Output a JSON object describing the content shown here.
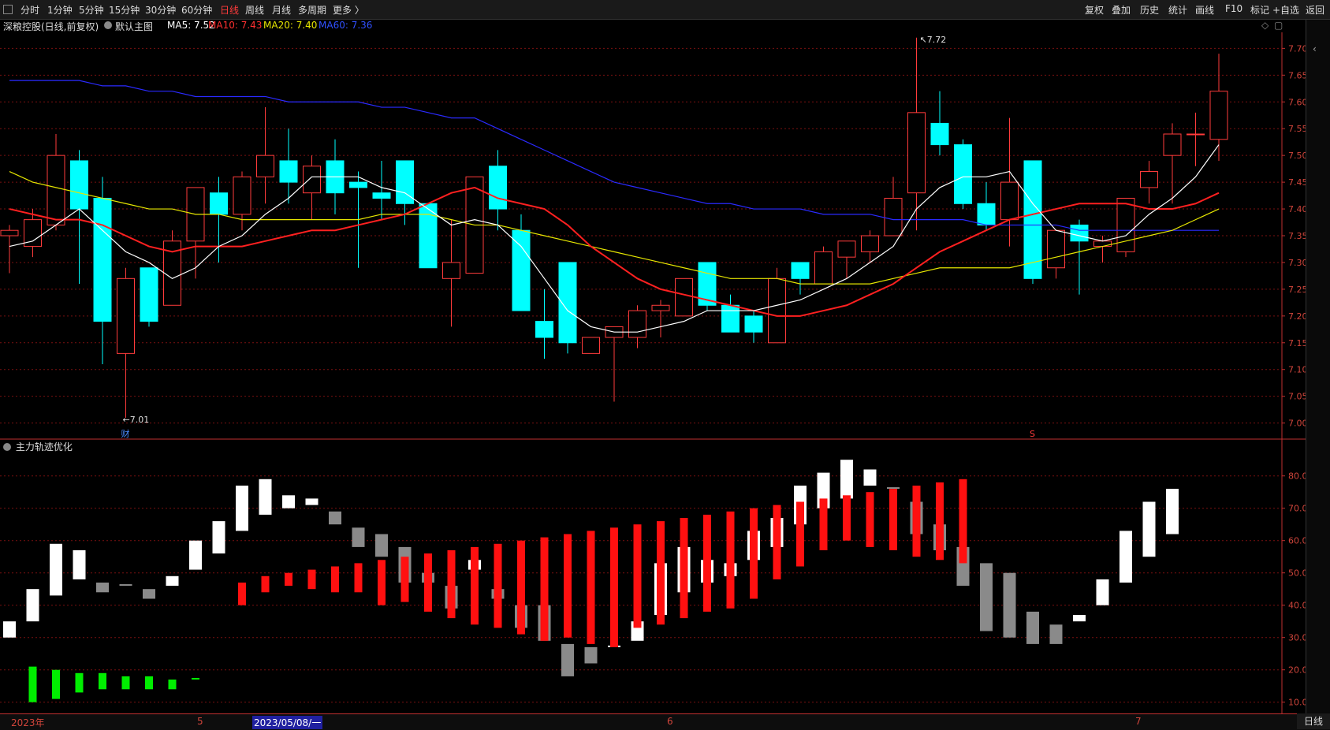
{
  "toolbar": {
    "periods": [
      "分时",
      "1分钟",
      "5分钟",
      "15分钟",
      "30分钟",
      "60分钟",
      "日线",
      "周线",
      "月线",
      "多周期",
      "更多 〉"
    ],
    "active_period": "日线",
    "right": [
      "复权",
      "叠加",
      "历史",
      "统计",
      "画线",
      "F10",
      "标记",
      "+自选",
      "返回"
    ]
  },
  "info": {
    "stock": "深粮控股(日线,前复权)",
    "template": "默认主图",
    "ma5": "MA5: 7.52",
    "ma10": "MA10: 7.43",
    "ma20": "MA20: 7.40",
    "ma60": "MA60: 7.36"
  },
  "indicator": {
    "name": "主力轨迹优化"
  },
  "annotations": {
    "high": "7.72",
    "low": "←7.01",
    "fin_marker": "财",
    "s_marker": "S"
  },
  "bottom": {
    "labels": [
      "2023年",
      "5",
      "2023/05/08/一",
      "6",
      "7"
    ],
    "period_button": "日线"
  },
  "colors": {
    "up": "#ff3b3b",
    "down": "#00ffff",
    "ma5": "#ffffff",
    "ma10": "#ff2020",
    "ma20": "#e6e600",
    "ma60": "#2a2aff",
    "grid": "#7a1010",
    "axis": "#c03030"
  },
  "chart_data": {
    "type": "candlestick",
    "y_range": [
      6.97,
      7.73
    ],
    "y_ticks": [
      "7.70",
      "7.65",
      "7.60",
      "7.55",
      "7.50",
      "7.45",
      "7.40",
      "7.35",
      "7.30",
      "7.25",
      "7.20",
      "7.15",
      "7.10",
      "7.05",
      "7.00"
    ],
    "ohlc": [
      [
        7.35,
        7.36,
        7.28,
        7.37
      ],
      [
        7.33,
        7.38,
        7.31,
        7.4
      ],
      [
        7.37,
        7.5,
        7.36,
        7.54
      ],
      [
        7.49,
        7.4,
        7.26,
        7.51
      ],
      [
        7.42,
        7.19,
        7.11,
        7.46
      ],
      [
        7.13,
        7.27,
        7.01,
        7.29
      ],
      [
        7.29,
        7.19,
        7.18,
        7.29
      ],
      [
        7.22,
        7.34,
        7.22,
        7.36
      ],
      [
        7.34,
        7.44,
        7.27,
        7.44
      ],
      [
        7.43,
        7.39,
        7.3,
        7.46
      ],
      [
        7.39,
        7.46,
        7.36,
        7.47
      ],
      [
        7.46,
        7.5,
        7.41,
        7.59
      ],
      [
        7.49,
        7.45,
        7.41,
        7.55
      ],
      [
        7.43,
        7.48,
        7.38,
        7.5
      ],
      [
        7.49,
        7.43,
        7.39,
        7.53
      ],
      [
        7.45,
        7.44,
        7.29,
        7.47
      ],
      [
        7.43,
        7.42,
        7.38,
        7.49
      ],
      [
        7.49,
        7.41,
        7.37,
        7.49
      ],
      [
        7.41,
        7.29,
        7.29,
        7.41
      ],
      [
        7.27,
        7.3,
        7.18,
        7.38
      ],
      [
        7.28,
        7.46,
        7.28,
        7.46
      ],
      [
        7.48,
        7.4,
        7.36,
        7.51
      ],
      [
        7.36,
        7.21,
        7.21,
        7.39
      ],
      [
        7.19,
        7.16,
        7.12,
        7.25
      ],
      [
        7.3,
        7.15,
        7.13,
        7.3
      ],
      [
        7.13,
        7.16,
        7.13,
        7.16
      ],
      [
        7.16,
        7.18,
        7.04,
        7.18
      ],
      [
        7.16,
        7.21,
        7.14,
        7.22
      ],
      [
        7.21,
        7.22,
        7.16,
        7.23
      ],
      [
        7.2,
        7.27,
        7.2,
        7.27
      ],
      [
        7.3,
        7.22,
        7.21,
        7.3
      ],
      [
        7.22,
        7.17,
        7.17,
        7.24
      ],
      [
        7.2,
        7.17,
        7.15,
        7.21
      ],
      [
        7.15,
        7.27,
        7.15,
        7.29
      ],
      [
        7.3,
        7.27,
        7.24,
        7.3
      ],
      [
        7.26,
        7.32,
        7.26,
        7.33
      ],
      [
        7.31,
        7.34,
        7.27,
        7.34
      ],
      [
        7.32,
        7.35,
        7.3,
        7.36
      ],
      [
        7.35,
        7.42,
        7.35,
        7.46
      ],
      [
        7.43,
        7.58,
        7.36,
        7.72
      ],
      [
        7.56,
        7.52,
        7.5,
        7.62
      ],
      [
        7.52,
        7.41,
        7.4,
        7.53
      ],
      [
        7.41,
        7.37,
        7.36,
        7.45
      ],
      [
        7.38,
        7.45,
        7.33,
        7.57
      ],
      [
        7.49,
        7.27,
        7.26,
        7.49
      ],
      [
        7.29,
        7.36,
        7.27,
        7.36
      ],
      [
        7.37,
        7.34,
        7.24,
        7.38
      ],
      [
        7.33,
        7.34,
        7.3,
        7.35
      ],
      [
        7.32,
        7.42,
        7.31,
        7.42
      ],
      [
        7.44,
        7.47,
        7.41,
        7.49
      ],
      [
        7.5,
        7.54,
        7.41,
        7.56
      ],
      [
        7.54,
        7.54,
        7.48,
        7.58
      ],
      [
        7.53,
        7.62,
        7.49,
        7.69
      ]
    ],
    "ma5": [
      7.33,
      7.34,
      7.37,
      7.4,
      7.36,
      7.32,
      7.3,
      7.27,
      7.29,
      7.33,
      7.35,
      7.39,
      7.42,
      7.46,
      7.46,
      7.46,
      7.44,
      7.43,
      7.4,
      7.37,
      7.38,
      7.37,
      7.33,
      7.27,
      7.21,
      7.18,
      7.17,
      7.17,
      7.18,
      7.19,
      7.21,
      7.21,
      7.21,
      7.22,
      7.23,
      7.25,
      7.27,
      7.3,
      7.33,
      7.4,
      7.44,
      7.46,
      7.46,
      7.47,
      7.41,
      7.36,
      7.35,
      7.34,
      7.35,
      7.39,
      7.42,
      7.46,
      7.52
    ],
    "ma10": [
      7.4,
      7.39,
      7.38,
      7.38,
      7.37,
      7.35,
      7.33,
      7.32,
      7.33,
      7.33,
      7.33,
      7.34,
      7.35,
      7.36,
      7.36,
      7.37,
      7.38,
      7.39,
      7.41,
      7.43,
      7.44,
      7.42,
      7.41,
      7.4,
      7.37,
      7.33,
      7.3,
      7.27,
      7.25,
      7.24,
      7.23,
      7.22,
      7.21,
      7.2,
      7.2,
      7.21,
      7.22,
      7.24,
      7.26,
      7.29,
      7.32,
      7.34,
      7.36,
      7.38,
      7.39,
      7.4,
      7.41,
      7.41,
      7.41,
      7.4,
      7.4,
      7.41,
      7.43
    ],
    "ma20": [
      7.47,
      7.45,
      7.44,
      7.43,
      7.42,
      7.41,
      7.4,
      7.4,
      7.39,
      7.39,
      7.38,
      7.38,
      7.38,
      7.38,
      7.38,
      7.38,
      7.39,
      7.39,
      7.39,
      7.38,
      7.37,
      7.37,
      7.36,
      7.35,
      7.34,
      7.33,
      7.32,
      7.31,
      7.3,
      7.29,
      7.28,
      7.27,
      7.27,
      7.27,
      7.26,
      7.26,
      7.26,
      7.26,
      7.27,
      7.28,
      7.29,
      7.29,
      7.29,
      7.29,
      7.3,
      7.31,
      7.32,
      7.33,
      7.34,
      7.35,
      7.36,
      7.38,
      7.4
    ],
    "ma60": [
      7.64,
      7.64,
      7.64,
      7.64,
      7.63,
      7.63,
      7.62,
      7.62,
      7.61,
      7.61,
      7.61,
      7.61,
      7.6,
      7.6,
      7.6,
      7.6,
      7.59,
      7.59,
      7.58,
      7.57,
      7.57,
      7.55,
      7.53,
      7.51,
      7.49,
      7.47,
      7.45,
      7.44,
      7.43,
      7.42,
      7.41,
      7.41,
      7.4,
      7.4,
      7.4,
      7.39,
      7.39,
      7.39,
      7.38,
      7.38,
      7.38,
      7.38,
      7.37,
      7.37,
      7.37,
      7.37,
      7.36,
      7.36,
      7.36,
      7.36,
      7.36,
      7.36,
      7.36
    ]
  },
  "indicator_data": {
    "y_range": [
      7,
      87
    ],
    "y_ticks": [
      "80.00",
      "70.00",
      "60.00",
      "50.00",
      "40.00",
      "30.00",
      "20.00",
      "10.00"
    ],
    "bars": [
      [
        "w",
        30,
        35
      ],
      [
        "w",
        35,
        45
      ],
      [
        "w",
        43,
        59
      ],
      [
        "w",
        48,
        57
      ],
      [
        "g",
        44,
        47
      ],
      [
        "g",
        46,
        46.5
      ],
      [
        "g",
        42,
        45
      ],
      [
        "w",
        46,
        49
      ],
      [
        "w",
        51,
        60
      ],
      [
        "w",
        56,
        66
      ],
      [
        "w",
        63,
        77
      ],
      [
        "w",
        68,
        79
      ],
      [
        "w",
        70,
        74
      ],
      [
        "w",
        71,
        73
      ],
      [
        "g",
        65,
        69
      ],
      [
        "g",
        58,
        64
      ],
      [
        "g",
        55,
        62
      ],
      [
        "g",
        47,
        58
      ],
      [
        "g",
        47,
        50
      ],
      [
        "g",
        39,
        46
      ],
      [
        "w",
        51,
        54
      ],
      [
        "g",
        42,
        45
      ],
      [
        "g",
        33,
        40
      ],
      [
        "g",
        29,
        40
      ],
      [
        "g",
        18,
        28
      ],
      [
        "g",
        22,
        27
      ],
      [
        "w",
        27,
        27.5
      ],
      [
        "w",
        29,
        35
      ],
      [
        "w",
        37,
        53
      ],
      [
        "w",
        44,
        58
      ],
      [
        "w",
        47,
        54
      ],
      [
        "w",
        49,
        53
      ],
      [
        "w",
        54,
        63
      ],
      [
        "w",
        58,
        67
      ],
      [
        "w",
        65,
        77
      ],
      [
        "w",
        70,
        81
      ],
      [
        "w",
        73,
        85
      ],
      [
        "w",
        77,
        82
      ],
      [
        "g",
        76,
        76.5
      ],
      [
        "g",
        62,
        72
      ],
      [
        "g",
        57,
        65
      ],
      [
        "g",
        46,
        58
      ],
      [
        "g",
        32,
        53
      ],
      [
        "g",
        30,
        50
      ],
      [
        "g",
        28,
        38
      ],
      [
        "g",
        28,
        34
      ],
      [
        "w",
        35,
        37
      ],
      [
        "w",
        40,
        48
      ],
      [
        "w",
        47,
        63
      ],
      [
        "w",
        55,
        72
      ],
      [
        "w",
        62,
        76
      ]
    ],
    "reds": [
      [
        47,
        40
      ],
      [
        49,
        44
      ],
      [
        50,
        46
      ],
      [
        51,
        45
      ],
      [
        52,
        44
      ],
      [
        53,
        44
      ],
      [
        54,
        40
      ],
      [
        55,
        41
      ],
      [
        56,
        38
      ],
      [
        57,
        36
      ],
      [
        58,
        34
      ],
      [
        59,
        33
      ],
      [
        60,
        31
      ],
      [
        61,
        29
      ],
      [
        62,
        30
      ],
      [
        63,
        28
      ],
      [
        64,
        27
      ],
      [
        65,
        33
      ],
      [
        66,
        34
      ],
      [
        67,
        36
      ],
      [
        68,
        38
      ],
      [
        69,
        39
      ],
      [
        70,
        42
      ],
      [
        71,
        48
      ],
      [
        72,
        52
      ],
      [
        73,
        57
      ],
      [
        74,
        60
      ],
      [
        75,
        58
      ],
      [
        76,
        57
      ],
      [
        77,
        55
      ],
      [
        78,
        54
      ],
      [
        79,
        53
      ]
    ],
    "greens": [
      [
        1,
        10,
        21
      ],
      [
        2,
        11,
        20
      ],
      [
        3,
        13,
        19
      ],
      [
        4,
        14,
        19
      ],
      [
        5,
        14,
        18
      ],
      [
        6,
        14,
        18
      ],
      [
        7,
        14,
        17
      ],
      [
        8,
        17,
        17.5
      ]
    ]
  }
}
